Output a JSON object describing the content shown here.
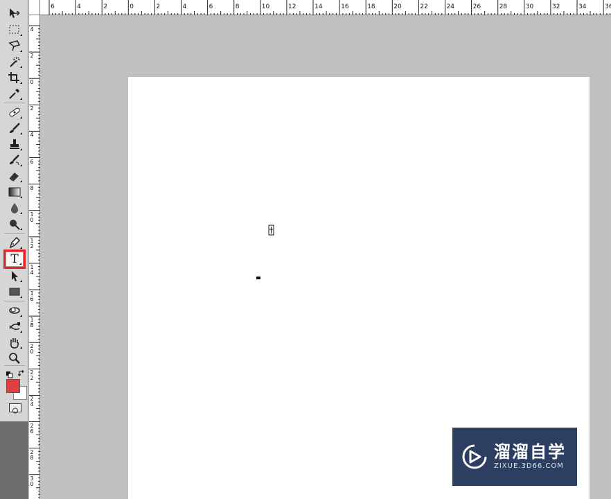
{
  "ruler_top": {
    "labels": [
      "6",
      "4",
      "2",
      "0",
      "2",
      "4",
      "6",
      "8",
      "10",
      "12",
      "14",
      "16",
      "18",
      "20",
      "22",
      "24",
      "26",
      "28",
      "30",
      "32",
      "34",
      "36"
    ]
  },
  "ruler_left": {
    "labels": [
      "4",
      "2",
      "0",
      "2",
      "4",
      "6",
      "8",
      "10",
      "12",
      "14",
      "16",
      "18",
      "20",
      "22",
      "24",
      "26",
      "28",
      "30"
    ]
  },
  "tools": [
    {
      "name": "move-tool"
    },
    {
      "name": "marquee-tool"
    },
    {
      "name": "lasso-tool"
    },
    {
      "name": "quick-selection-tool"
    },
    {
      "name": "crop-tool"
    },
    {
      "name": "eyedropper-tool"
    },
    {
      "name": "healing-brush-tool"
    },
    {
      "name": "brush-tool"
    },
    {
      "name": "clone-stamp-tool"
    },
    {
      "name": "history-brush-tool"
    },
    {
      "name": "eraser-tool"
    },
    {
      "name": "gradient-tool"
    },
    {
      "name": "blur-tool"
    },
    {
      "name": "dodge-tool"
    },
    {
      "name": "pen-tool"
    },
    {
      "name": "type-tool",
      "label": "T",
      "selected": true
    },
    {
      "name": "path-selection-tool"
    },
    {
      "name": "rectangle-tool"
    },
    {
      "name": "3d-rotate-tool"
    },
    {
      "name": "3d-orbit-tool"
    },
    {
      "name": "hand-tool"
    },
    {
      "name": "zoom-tool"
    }
  ],
  "colors": {
    "foreground": "#e04040",
    "background": "#ffffff",
    "selection_outline": "#e8242a",
    "watermark_bg": "#2c3e62"
  },
  "watermark": {
    "cn": "溜溜自学",
    "en": "ZIXUE.3D66.COM"
  }
}
